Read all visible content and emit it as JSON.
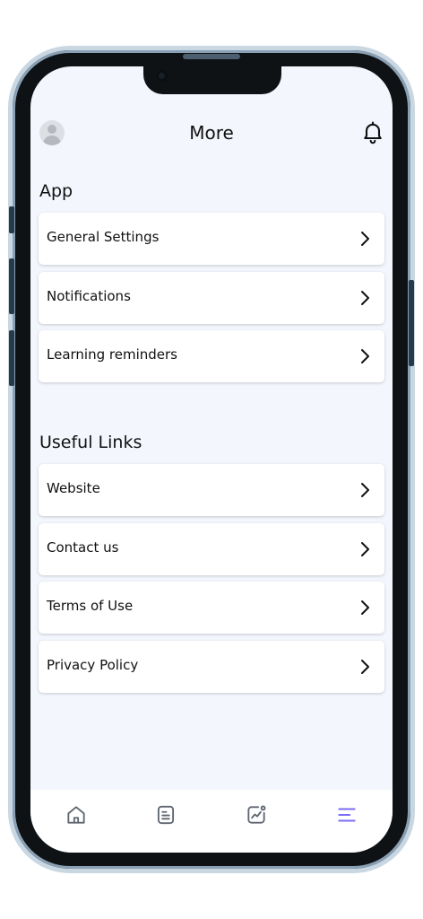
{
  "header": {
    "title": "More",
    "avatar_icon": "user-avatar",
    "bell_icon": "bell-icon"
  },
  "sections": [
    {
      "title": "App",
      "items": [
        {
          "label": "General Settings"
        },
        {
          "label": "Notifications"
        },
        {
          "label": "Learning reminders"
        }
      ]
    },
    {
      "title": "Useful Links",
      "items": [
        {
          "label": "Website"
        },
        {
          "label": "Contact us"
        },
        {
          "label": "Terms of Use"
        },
        {
          "label": "Privacy Policy"
        }
      ]
    }
  ],
  "tabbar": {
    "tabs": [
      {
        "icon": "home-icon"
      },
      {
        "icon": "notes-icon"
      },
      {
        "icon": "chart-icon"
      },
      {
        "icon": "menu-icon",
        "active": true
      }
    ],
    "active_color": "#7b6cf6",
    "inactive_color": "#5f6670"
  },
  "colors": {
    "screen_background": "#f3f6fd",
    "card_background": "#ffffff",
    "text": "#111111"
  }
}
